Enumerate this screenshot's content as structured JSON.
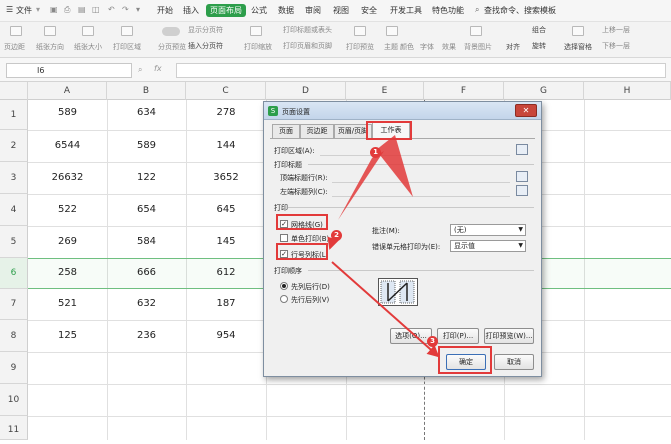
{
  "menubar": {
    "file_menu": "文件",
    "tabs": [
      "开始",
      "插入",
      "页面布局",
      "公式",
      "数据",
      "审阅",
      "视图",
      "安全",
      "开发工具",
      "特色功能"
    ],
    "active_tab": "页面布局",
    "search": "查找命令、搜索模板"
  },
  "ribbon": {
    "page_margins": "页边距",
    "orientation": "纸张方向",
    "paper_size": "纸张大小",
    "print_area": "打印区域",
    "page_break_preview": "分页预览",
    "show_page_breaks": "显示分页符",
    "insert_page_break": "插入分页符",
    "print_titles": "打印标题或表头",
    "print_header_footer": "打印页眉和页脚",
    "print_scaling": "打印缩放",
    "print_preview": "打印预览",
    "theme": "主题",
    "colors": "颜色",
    "fonts": "字体",
    "effects": "效果",
    "background": "背景图片",
    "align": "对齐",
    "group": "组合",
    "rotate": "旋转",
    "selection_pane": "选择窗格",
    "bring_forward": "上移一层",
    "send_backward": "下移一层"
  },
  "formula_bar": {
    "cell_ref": "I6",
    "fx": "fx"
  },
  "sheet": {
    "columns": [
      "A",
      "B",
      "C",
      "D",
      "E",
      "F",
      "G",
      "H"
    ],
    "rows": [
      "1",
      "2",
      "3",
      "4",
      "5",
      "6",
      "7",
      "8",
      "9",
      "10",
      "11"
    ],
    "data": [
      [
        "589",
        "634",
        "278"
      ],
      [
        "6544",
        "589",
        "144"
      ],
      [
        "26632",
        "122",
        "3652"
      ],
      [
        "522",
        "654",
        "645"
      ],
      [
        "269",
        "584",
        "145"
      ],
      [
        "258",
        "666",
        "612"
      ],
      [
        "521",
        "632",
        "187"
      ],
      [
        "125",
        "236",
        "954"
      ]
    ]
  },
  "dialog": {
    "title": "页面设置",
    "tabs": [
      "页面",
      "页边距",
      "页眉/页脚",
      "工作表"
    ],
    "active_tab": "工作表",
    "print_area_label": "打印区域(A):",
    "print_titles_label": "打印标题",
    "title_rows_label": "顶端标题行(R):",
    "title_cols_label": "左端标题列(C):",
    "print_label": "打印",
    "gridlines_label": "网格线(G)",
    "gridlines_checked": true,
    "mono_label": "单色打印(B)",
    "mono_checked": false,
    "row_col_headings_label": "行号列标(L)",
    "row_col_headings_checked": true,
    "comments_label": "批注(M):",
    "comments_value": "(无)",
    "errors_label": "错误单元格打印为(E):",
    "errors_value": "显示值",
    "page_order_label": "打印顺序",
    "down_then_over": "先列后行(D)",
    "over_then_down": "先行后列(V)",
    "page_order_selected": "先列后行(D)",
    "options_button": "选项(O)...",
    "print_button": "打印(P)...",
    "print_preview_button": "打印预览(W)...",
    "ok_button": "确定",
    "cancel_button": "取消"
  },
  "annotations": {
    "step1": "1",
    "step2": "2",
    "step3": "3"
  }
}
